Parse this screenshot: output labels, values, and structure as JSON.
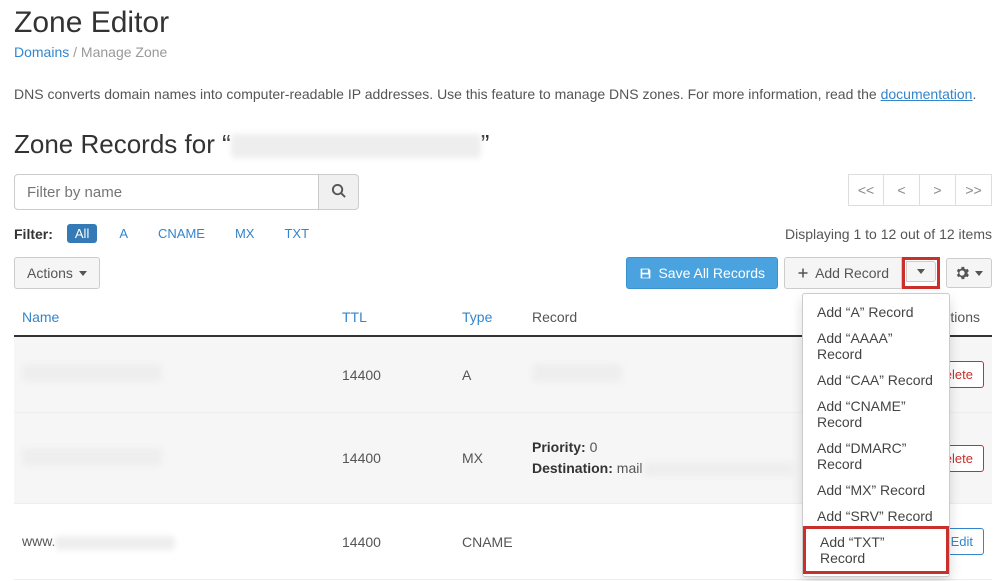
{
  "page": {
    "title": "Zone Editor",
    "breadcrumb_root": "Domains",
    "breadcrumb_sep": "/",
    "breadcrumb_current": "Manage Zone",
    "description_1": "DNS converts domain names into computer-readable IP addresses. Use this feature to manage DNS zones. For more information, read the ",
    "doc_link": "documentation",
    "description_2": ".",
    "records_heading_prefix": "Zone Records for “",
    "records_heading_suffix": "”"
  },
  "search": {
    "placeholder": "Filter by name"
  },
  "pager": {
    "first": "<<",
    "prev": "<",
    "next": ">",
    "last": ">>"
  },
  "filter": {
    "label": "Filter:",
    "tabs": [
      "All",
      "A",
      "CNAME",
      "MX",
      "TXT"
    ],
    "displaying": "Displaying 1 to 12 out of 12 items"
  },
  "actions": {
    "actions_btn": "Actions",
    "save_all": "Save All Records",
    "add_record": "Add Record",
    "edit": "Edit",
    "delete": "Delete"
  },
  "dropdown": {
    "items": [
      "Add “A” Record",
      "Add “AAAA” Record",
      "Add “CAA” Record",
      "Add “CNAME” Record",
      "Add “DMARC” Record",
      "Add “MX” Record",
      "Add “SRV” Record",
      "Add “TXT” Record"
    ]
  },
  "table": {
    "headers": {
      "name": "Name",
      "ttl": "TTL",
      "type": "Type",
      "record": "Record",
      "actions": "Actions"
    },
    "rows": [
      {
        "ttl": "14400",
        "type": "A",
        "record_plain": ""
      },
      {
        "ttl": "14400",
        "type": "MX",
        "priority_label": "Priority:",
        "priority": "0",
        "dest_label": "Destination:",
        "dest": "mail"
      },
      {
        "name_prefix": "www.",
        "ttl": "14400",
        "type": "CNAME"
      }
    ]
  }
}
